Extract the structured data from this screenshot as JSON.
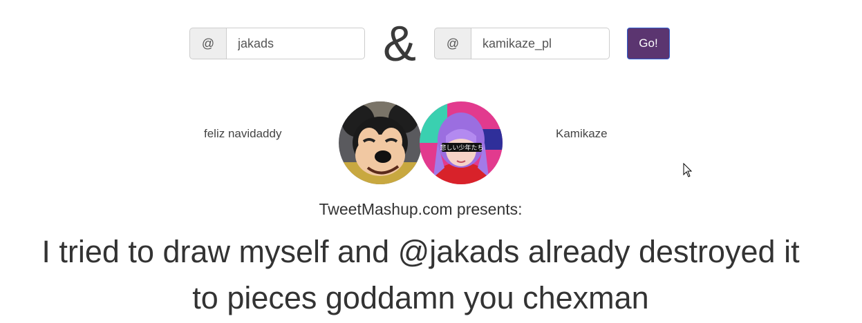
{
  "form": {
    "left_addon": "@",
    "left_handle": "jakads",
    "separator": "&",
    "right_addon": "@",
    "right_handle": "kamikaze_pl",
    "go_label": "Go!",
    "go_color": "#5b3570"
  },
  "users": {
    "left": {
      "display_name": "feliz navidaddy",
      "avatar_icon": "mickey-mouse-avatar"
    },
    "right": {
      "display_name": "Kamikaze",
      "avatar_icon": "anime-girl-avatar",
      "avatar_caption": "悲しい少年たち"
    }
  },
  "result": {
    "presents": "TweetMashup.com presents:",
    "tweet_line1": "I tried to draw myself and @jakads already destroyed it",
    "tweet_line2": "to pieces goddamn you chexman"
  }
}
